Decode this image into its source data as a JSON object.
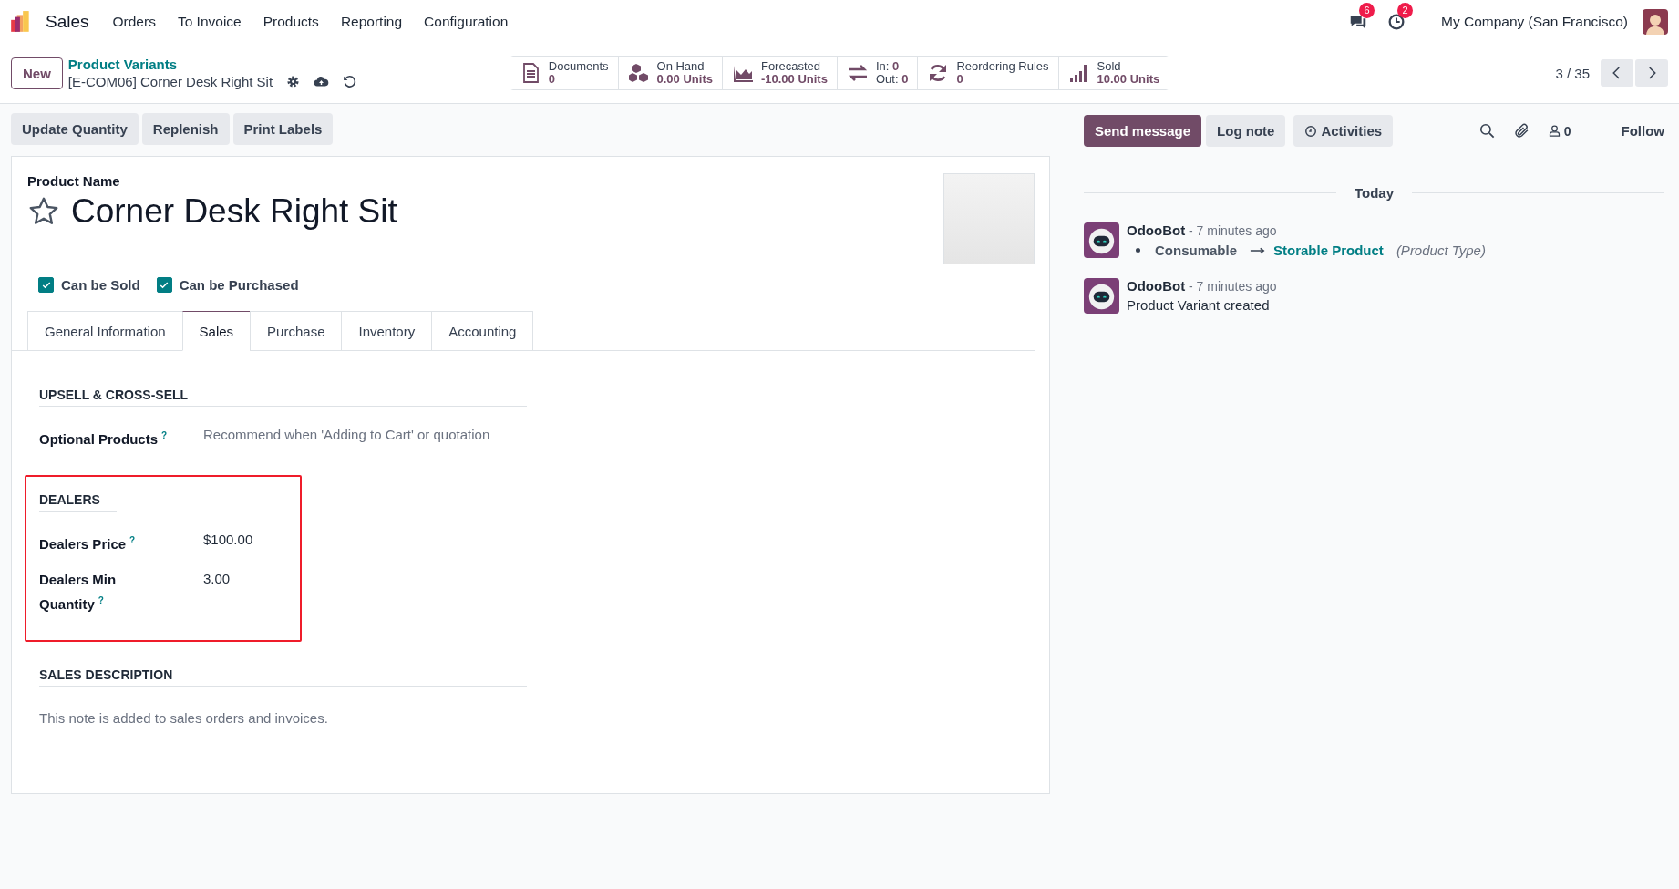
{
  "app": {
    "name": "Sales",
    "menu": [
      "Orders",
      "To Invoice",
      "Products",
      "Reporting",
      "Configuration"
    ]
  },
  "systray": {
    "messages_badge": "6",
    "activities_badge": "2",
    "company": "My Company (San Francisco)"
  },
  "control_panel": {
    "new_button": "New",
    "breadcrumb": "Product Variants",
    "record_title": "[E-COM06] Corner Desk Right Sit",
    "stat_buttons": [
      {
        "kind": "documents",
        "lines": [
          {
            "label": "Documents",
            "value": "0"
          }
        ]
      },
      {
        "kind": "on_hand",
        "lines": [
          {
            "label": "On Hand",
            "value": "0.00 Units"
          }
        ]
      },
      {
        "kind": "forecast",
        "lines": [
          {
            "label": "Forecasted",
            "value": "-10.00 Units"
          }
        ]
      },
      {
        "kind": "transfers",
        "lines": [
          {
            "label": "In:",
            "value": "0"
          },
          {
            "label": "Out:",
            "value": "0"
          }
        ]
      },
      {
        "kind": "reordering",
        "lines": [
          {
            "label": "Reordering Rules",
            "value": "0"
          }
        ]
      },
      {
        "kind": "sold",
        "lines": [
          {
            "label": "Sold",
            "value": "10.00 Units"
          }
        ]
      }
    ],
    "pager": "3 / 35"
  },
  "actions": [
    "Update Quantity",
    "Replenish",
    "Print Labels"
  ],
  "form": {
    "name_label": "Product Name",
    "name": "Corner Desk Right Sit",
    "favorite": false,
    "checkboxes": [
      {
        "label": "Can be Sold",
        "checked": true
      },
      {
        "label": "Can be Purchased",
        "checked": true
      }
    ],
    "tabs": [
      {
        "label": "General Information",
        "selected": false
      },
      {
        "label": "Sales",
        "selected": true
      },
      {
        "label": "Purchase",
        "selected": false
      },
      {
        "label": "Inventory",
        "selected": false
      },
      {
        "label": "Accounting",
        "selected": false
      }
    ],
    "sections": [
      {
        "kind": "fields",
        "title": "UPSELL & CROSS-SELL",
        "highlighted": false,
        "fields": [
          {
            "label": "Optional Products",
            "help": "?",
            "placeholder": "Recommend when 'Adding to Cart' or quotation"
          }
        ]
      },
      {
        "kind": "fields",
        "title": "DEALERS",
        "highlighted": true,
        "fields": [
          {
            "label": "Dealers Price",
            "help": "?",
            "value": "$100.00"
          },
          {
            "label": "Dealers Min Quantity",
            "help": "?",
            "value": "3.00"
          }
        ]
      },
      {
        "kind": "note",
        "title": "SALES DESCRIPTION",
        "highlighted": false,
        "placeholder": "This note is added to sales orders and invoices."
      }
    ]
  },
  "chatter": {
    "buttons": [
      {
        "label": "Send message",
        "primary": true,
        "kind": "plain"
      },
      {
        "label": "Log note",
        "primary": false,
        "kind": "plain"
      },
      {
        "label": "Activities",
        "primary": false,
        "kind": "clock"
      }
    ],
    "follower_count": "0",
    "follow": "Follow",
    "date_separator": "Today",
    "messages": [
      {
        "kind": "tracking",
        "author": "OdooBot",
        "time": "- 7 minutes ago",
        "old": "Consumable",
        "new": "Storable Product",
        "field": "(Product Type)"
      },
      {
        "kind": "text",
        "author": "OdooBot",
        "time": "- 7 minutes ago",
        "body": "Product Variant created"
      }
    ]
  }
}
